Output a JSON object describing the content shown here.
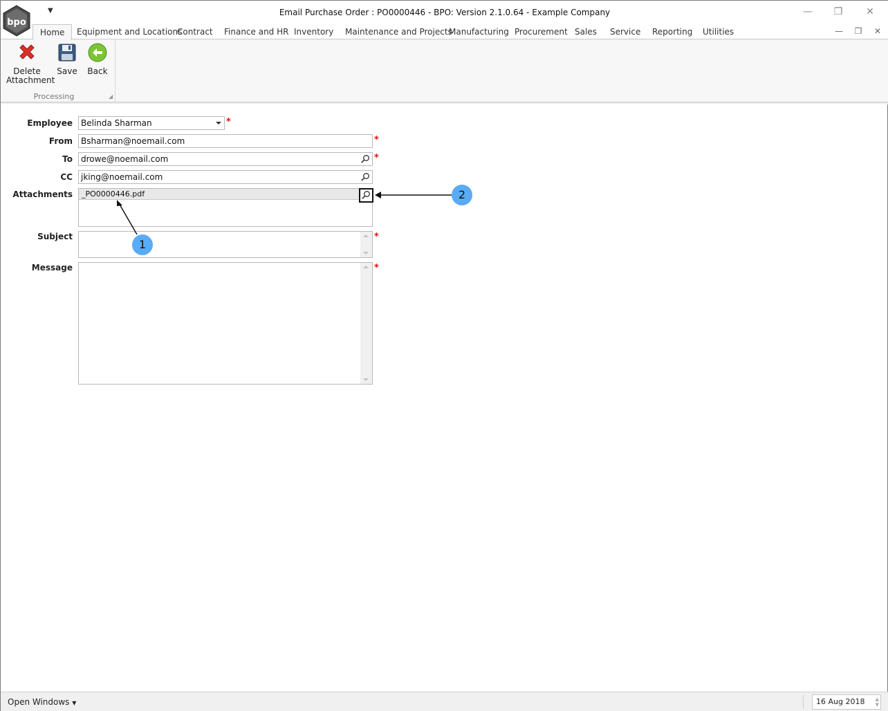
{
  "window": {
    "title": "Email Purchase Order : PO0000446 - BPO: Version 2.1.0.64 - Example Company",
    "logo_text": "bpo",
    "minimize": "—",
    "restore": "❐",
    "close": "✕"
  },
  "tabs": [
    {
      "label": "Home",
      "active": true
    },
    {
      "label": "Equipment and Locations"
    },
    {
      "label": "Contract"
    },
    {
      "label": "Finance and HR"
    },
    {
      "label": "Inventory"
    },
    {
      "label": "Maintenance and Projects"
    },
    {
      "label": "Manufacturing"
    },
    {
      "label": "Procurement"
    },
    {
      "label": "Sales"
    },
    {
      "label": "Service"
    },
    {
      "label": "Reporting"
    },
    {
      "label": "Utilities"
    }
  ],
  "ribbon": {
    "delete_label_line1": "Delete",
    "delete_label_line2": "Attachment",
    "save_label": "Save",
    "back_label": "Back",
    "group_label": "Processing"
  },
  "form": {
    "employee_label": "Employee",
    "employee_value": "Belinda Sharman",
    "from_label": "From",
    "from_value": "Bsharman@noemail.com",
    "to_label": "To",
    "to_value": "drowe@noemail.com",
    "cc_label": "CC",
    "cc_value": "jking@noemail.com",
    "attachments_label": "Attachments",
    "attachment_file": "_PO0000446.pdf",
    "subject_label": "Subject",
    "subject_value": "",
    "message_label": "Message",
    "message_value": "",
    "required_mark": "*"
  },
  "callouts": {
    "one": "1",
    "two": "2"
  },
  "statusbar": {
    "open_windows": "Open Windows",
    "date": "16 Aug 2018"
  },
  "colors": {
    "callout": "#5aabf5",
    "required": "#dd1111",
    "ribbon_bg": "#f7f7f7"
  }
}
